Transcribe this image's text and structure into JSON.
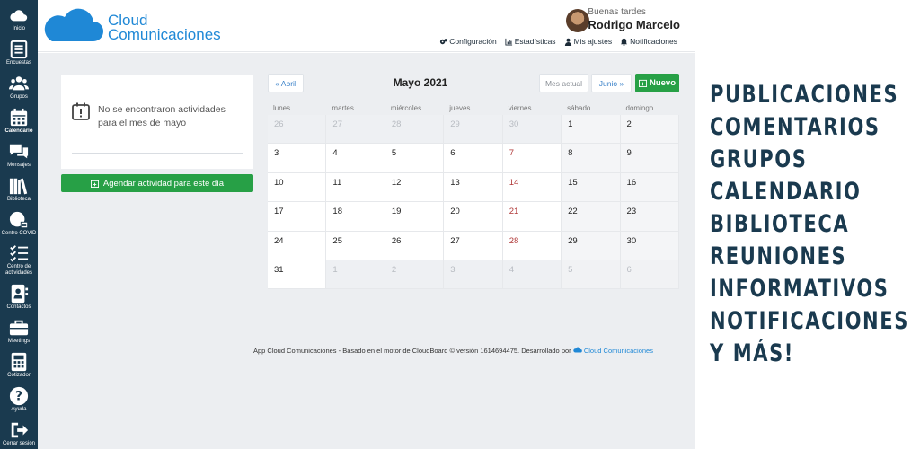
{
  "sidebar": {
    "items": [
      {
        "label": "Inicio",
        "icon": "cloud-icon"
      },
      {
        "label": "Encuestas",
        "icon": "list-icon"
      },
      {
        "label": "Grupos",
        "icon": "group-icon"
      },
      {
        "label": "Calendario",
        "icon": "calendar-icon"
      },
      {
        "label": "Mensajes",
        "icon": "chat-icon"
      },
      {
        "label": "Biblioteca",
        "icon": "books-icon"
      },
      {
        "label": "Centro COVID",
        "icon": "covid-icon"
      },
      {
        "label": "Centro de actividades",
        "icon": "checklist-icon"
      },
      {
        "label": "Contactos",
        "icon": "contacts-icon"
      },
      {
        "label": "Meetings",
        "icon": "briefcase-icon"
      },
      {
        "label": "Cotizador",
        "icon": "calculator-icon"
      },
      {
        "label": "Ayuda",
        "icon": "help-icon"
      },
      {
        "label": "Cerrar sesión",
        "icon": "logout-icon"
      }
    ]
  },
  "header": {
    "brand_line1": "Cloud",
    "brand_line2": "Comunicaciones",
    "greeting": "Buenas tardes",
    "user_name": "Rodrigo Marcelo",
    "nav": {
      "config": "Configuración",
      "stats": "Estadísticas",
      "settings": "Mis ajustes",
      "notifications": "Notificaciones"
    }
  },
  "panel": {
    "empty_message": "No se encontraron actividades para el mes de mayo",
    "schedule_button": "Agendar actividad para este día"
  },
  "calendar": {
    "prev_label": "« Abril",
    "title": "Mayo 2021",
    "current_label": "Mes actual",
    "next_label": "Junio »",
    "new_label": "Nuevo",
    "weekdays": [
      "lunes",
      "martes",
      "miércoles",
      "jueves",
      "viernes",
      "sábado",
      "domingo"
    ],
    "weeks": [
      [
        {
          "d": "26",
          "out": true
        },
        {
          "d": "27",
          "out": true
        },
        {
          "d": "28",
          "out": true
        },
        {
          "d": "29",
          "out": true
        },
        {
          "d": "30",
          "out": true
        },
        {
          "d": "1"
        },
        {
          "d": "2"
        }
      ],
      [
        {
          "d": "3"
        },
        {
          "d": "4"
        },
        {
          "d": "5"
        },
        {
          "d": "6"
        },
        {
          "d": "7"
        },
        {
          "d": "8"
        },
        {
          "d": "9"
        }
      ],
      [
        {
          "d": "10"
        },
        {
          "d": "11"
        },
        {
          "d": "12"
        },
        {
          "d": "13"
        },
        {
          "d": "14"
        },
        {
          "d": "15"
        },
        {
          "d": "16"
        }
      ],
      [
        {
          "d": "17"
        },
        {
          "d": "18"
        },
        {
          "d": "19"
        },
        {
          "d": "20"
        },
        {
          "d": "21"
        },
        {
          "d": "22"
        },
        {
          "d": "23"
        }
      ],
      [
        {
          "d": "24"
        },
        {
          "d": "25"
        },
        {
          "d": "26"
        },
        {
          "d": "27"
        },
        {
          "d": "28"
        },
        {
          "d": "29"
        },
        {
          "d": "30"
        }
      ],
      [
        {
          "d": "31"
        },
        {
          "d": "1",
          "out": true
        },
        {
          "d": "2",
          "out": true
        },
        {
          "d": "3",
          "out": true
        },
        {
          "d": "4",
          "out": true
        },
        {
          "d": "5",
          "out": true
        },
        {
          "d": "6",
          "out": true
        }
      ]
    ]
  },
  "footer": {
    "text": "App Cloud Comunicaciones - Basado en el motor de CloudBoard © versión 1614694475. Desarrollado por",
    "link": "Cloud Comunicaciones"
  },
  "promo": {
    "lines": [
      "PUBLICACIONES",
      "COMENTARIOS",
      "GRUPOS",
      "CALENDARIO",
      "BIBLIOTECA",
      "REUNIONES",
      "INFORMATIVOS",
      "NOTIFICACIONES",
      "Y MÁS!"
    ]
  },
  "colors": {
    "sidebar": "#1a3a4f",
    "brand_blue": "#1f88d6",
    "green": "#27a046",
    "promo_text": "#1a3a4f"
  }
}
